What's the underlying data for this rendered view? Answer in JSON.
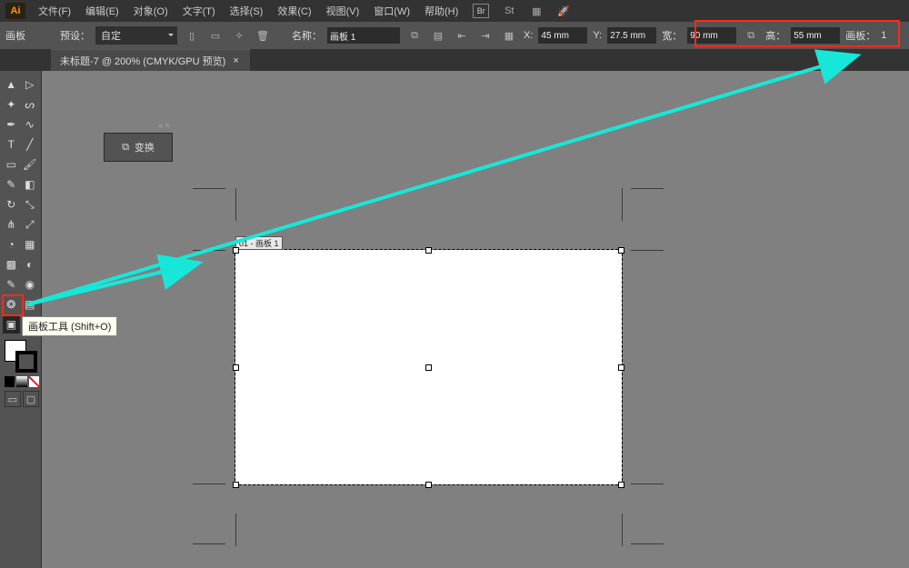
{
  "app": {
    "logo": "Ai"
  },
  "menu": {
    "file": "文件(F)",
    "edit": "编辑(E)",
    "object": "对象(O)",
    "type": "文字(T)",
    "select": "选择(S)",
    "effect": "效果(C)",
    "view": "视图(V)",
    "window": "窗口(W)",
    "help": "帮助(H)"
  },
  "control": {
    "panel_label": "画板",
    "preset_label": "预设：",
    "preset_value": "自定",
    "name_label": "名称：",
    "name_value": "画板 1",
    "x_label": "X:",
    "x_value": "45 mm",
    "y_label": "Y:",
    "y_value": "27.5 mm",
    "w_label": "宽：",
    "w_value": "90 mm",
    "h_label": "高：",
    "h_value": "55 mm",
    "artboard_index_label": "画板："
  },
  "tab": {
    "title": "未标题-7 @ 200% (CMYK/GPU 预览)"
  },
  "panel": {
    "transform_label": "变换"
  },
  "tooltip": {
    "artboard_tool": "画板工具 (Shift+O)"
  },
  "artboard": {
    "label": "01 - 画板 1"
  },
  "control_artboard_index": "1"
}
